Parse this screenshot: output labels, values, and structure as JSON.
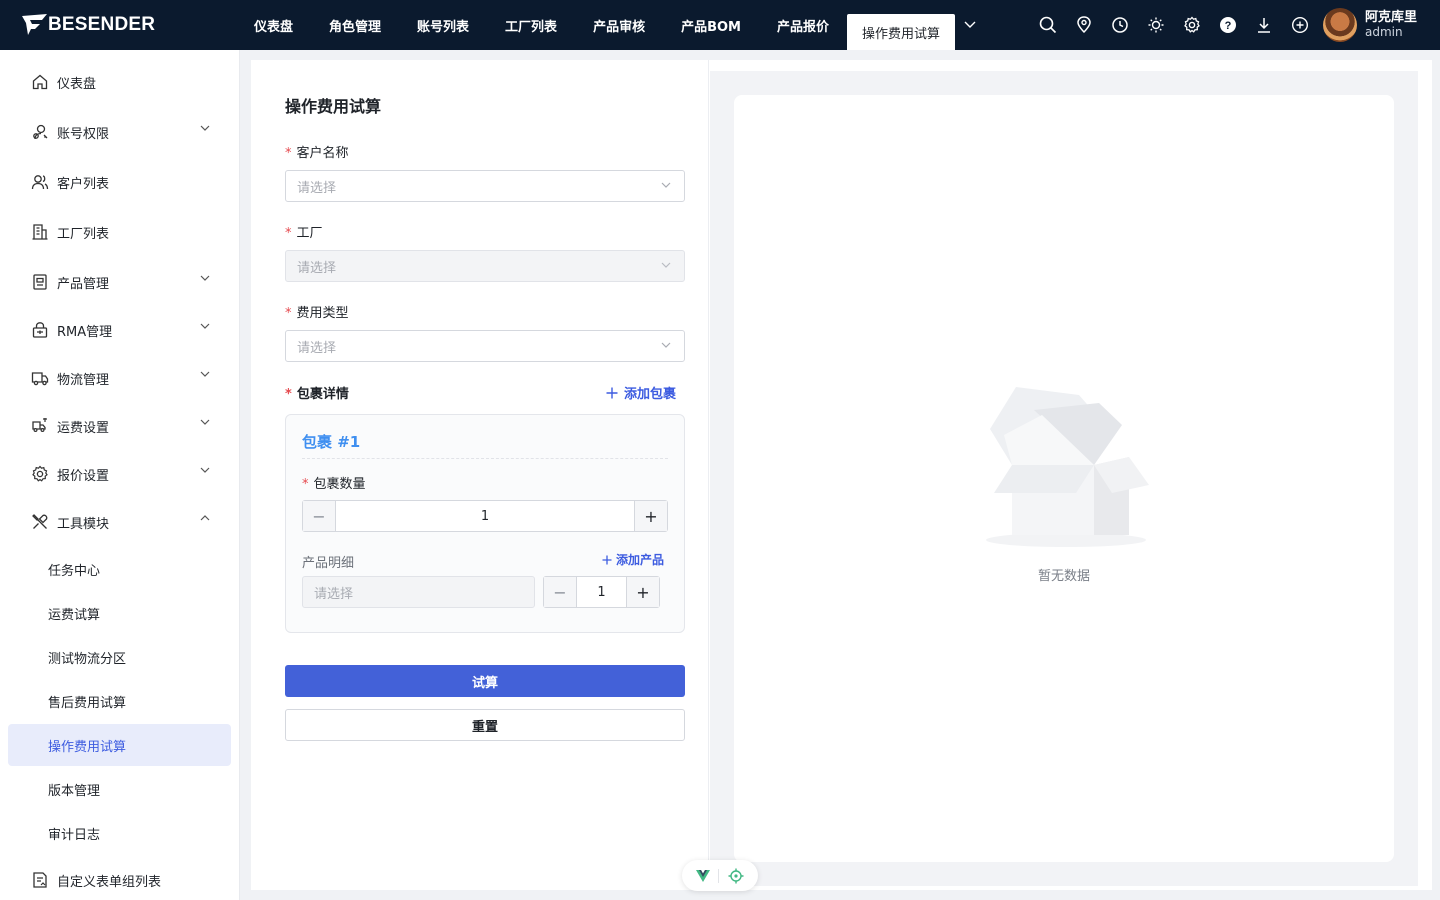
{
  "brand": {
    "logo_text": "BESENDER"
  },
  "topnav": {
    "items": [
      {
        "label": "仪表盘"
      },
      {
        "label": "角色管理"
      },
      {
        "label": "账号列表"
      },
      {
        "label": "工厂列表"
      },
      {
        "label": "产品审核"
      },
      {
        "label": "产品BOM"
      },
      {
        "label": "产品报价"
      }
    ],
    "active_tab": "操作费用试算",
    "tools": [
      "search-icon",
      "location-icon",
      "clock-icon",
      "sun-icon",
      "settings-icon",
      "help-icon",
      "download-icon",
      "add-circle-icon"
    ]
  },
  "user": {
    "name": "阿克库里",
    "role": "admin"
  },
  "sidebar": {
    "items": [
      {
        "label": "仪表盘",
        "icon": "home-icon"
      },
      {
        "label": "账号权限",
        "icon": "account-permission-icon",
        "expandable": true
      },
      {
        "label": "客户列表",
        "icon": "users-icon"
      },
      {
        "label": "工厂列表",
        "icon": "building-icon"
      },
      {
        "label": "产品管理",
        "icon": "product-icon",
        "expandable": true
      },
      {
        "label": "RMA管理",
        "icon": "rma-icon",
        "expandable": true
      },
      {
        "label": "物流管理",
        "icon": "truck-icon",
        "expandable": true
      },
      {
        "label": "运费设置",
        "icon": "freight-icon",
        "expandable": true
      },
      {
        "label": "报价设置",
        "icon": "gear-icon",
        "expandable": true
      },
      {
        "label": "工具模块",
        "icon": "tools-icon",
        "expandable": true,
        "expanded": true
      }
    ],
    "tool_subitems": [
      {
        "label": "任务中心"
      },
      {
        "label": "运费试算"
      },
      {
        "label": "测试物流分区"
      },
      {
        "label": "售后费用试算"
      },
      {
        "label": "操作费用试算",
        "active": true
      },
      {
        "label": "版本管理"
      },
      {
        "label": "审计日志"
      }
    ],
    "bottom_item": {
      "label": "自定义表单组列表",
      "icon": "form-group-icon"
    }
  },
  "form": {
    "title": "操作费用试算",
    "required_mark": "*",
    "customer": {
      "label": "客户名称",
      "placeholder": "请选择"
    },
    "factory": {
      "label": "工厂",
      "placeholder": "请选择"
    },
    "fee_type": {
      "label": "费用类型",
      "placeholder": "请选择"
    },
    "packages": {
      "label": "包裹详情",
      "add_label": "添加包裹",
      "items": [
        {
          "title": "包裹 #1",
          "qty_label": "包裹数量",
          "qty": "1",
          "product_label": "产品明细",
          "add_product_label": "添加产品",
          "product_placeholder": "请选择",
          "product_qty": "1"
        }
      ]
    },
    "submit_label": "试算",
    "reset_label": "重置"
  },
  "result": {
    "empty_text": "暂无数据"
  },
  "colors": {
    "primary": "#4361d8",
    "topbar": "#0b1a2e",
    "package_title": "#3f8ff0",
    "required": "#e5484d"
  }
}
